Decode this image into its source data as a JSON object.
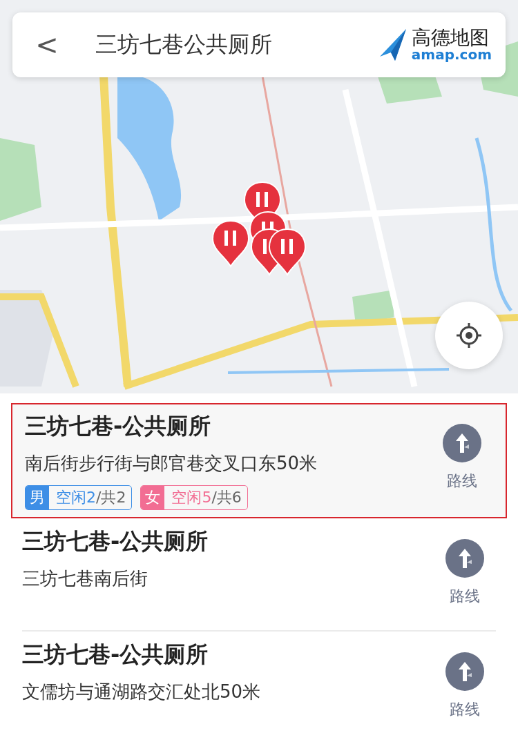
{
  "header": {
    "back": "<",
    "title": "三坊七巷公共厕所",
    "logo_name": "高德地图",
    "logo_domain": "amap.com"
  },
  "results": [
    {
      "title": "三坊七巷-公共厕所",
      "address": "南后街步行街与郎官巷交叉口东50米",
      "highlighted": true,
      "route": "路线",
      "tags": [
        {
          "label": "男",
          "free": "空闲2",
          "total": "/共2",
          "color": "#3d8ee6"
        },
        {
          "label": "女",
          "free": "空闲5",
          "total": "/共6",
          "color": "#f26d93"
        }
      ]
    },
    {
      "title": "三坊七巷-公共厕所",
      "address": "三坊七巷南后街",
      "highlighted": false,
      "route": "路线"
    },
    {
      "title": "三坊七巷-公共厕所",
      "address": "文儒坊与通湖路交汇处北50米",
      "highlighted": false,
      "route": "路线"
    }
  ]
}
